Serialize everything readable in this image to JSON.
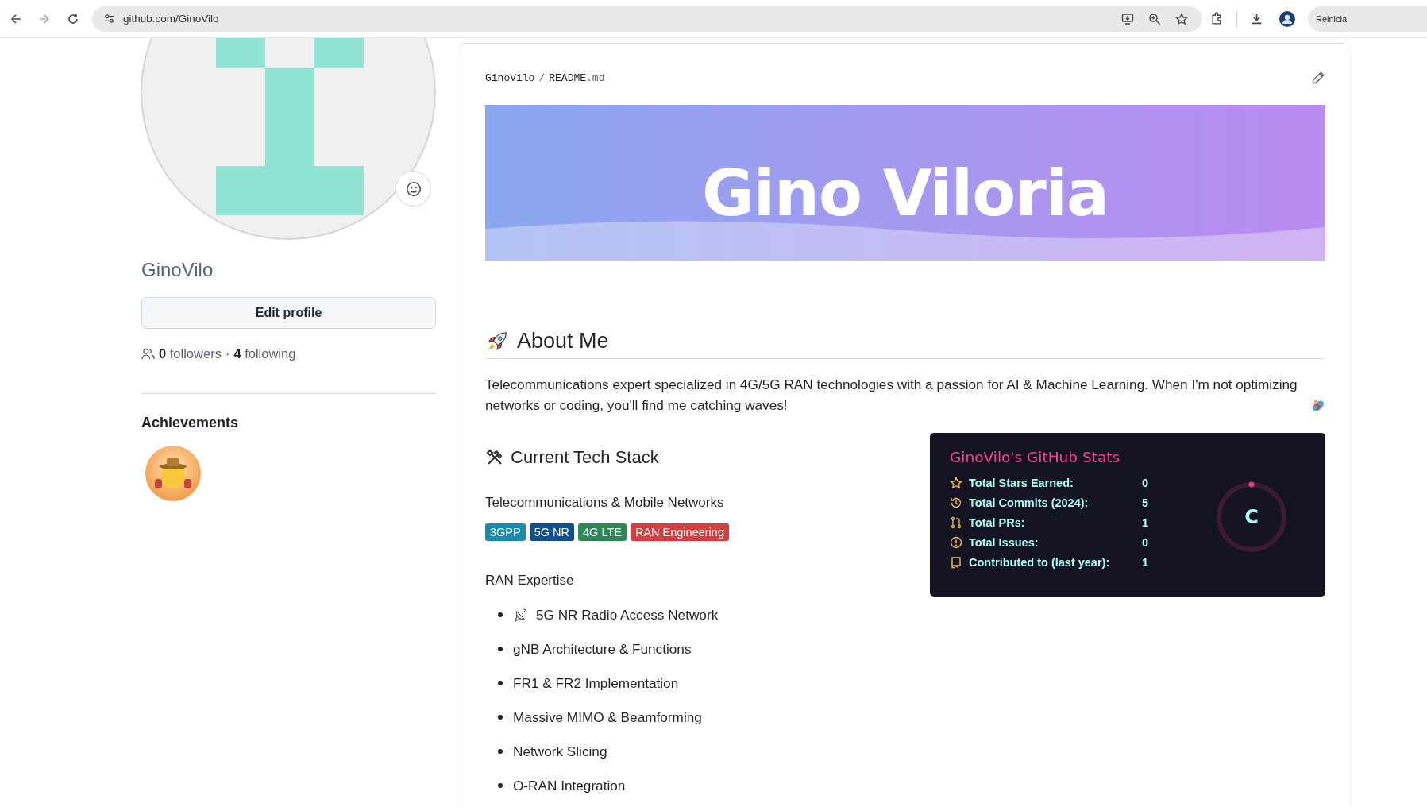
{
  "browser": {
    "url": "github.com/GinoVilo",
    "profile_button": "Reinicia"
  },
  "profile": {
    "username": "GinoVilo",
    "edit_button": "Edit profile",
    "followers_count": "0",
    "followers_label": "followers",
    "separator": "·",
    "following_count": "4",
    "following_label": "following",
    "achievements_title": "Achievements"
  },
  "readme": {
    "owner": "GinoVilo",
    "separator": "/",
    "file": "README.md",
    "banner_title": "Gino Viloria",
    "about_heading": "About Me",
    "about_text": "Telecommunications expert specialized in 4G/5G RAN technologies with a passion for AI & Machine Learning. When I'm not optimizing networks or coding, you'll find me catching waves!",
    "tech_heading": "Current Tech Stack",
    "telecom_heading": "Telecommunications & Mobile Networks",
    "badges": [
      {
        "label": "3GPP",
        "color": "#1a8cb0"
      },
      {
        "label": "5G NR",
        "color": "#0f4f8e"
      },
      {
        "label": "4G LTE",
        "color": "#2f8757"
      },
      {
        "label": "RAN Engineering",
        "color": "#d43f3f"
      }
    ],
    "ran_heading": "RAN Expertise",
    "ran_items": [
      {
        "text": "5G NR Radio Access Network",
        "kind": "satellite"
      },
      {
        "text": "gNB Architecture & Functions",
        "kind": "plain"
      },
      {
        "text": "FR1 & FR2 Implementation",
        "kind": "plain"
      },
      {
        "text": "Massive MIMO & Beamforming",
        "kind": "plain"
      },
      {
        "text": "Network Slicing",
        "kind": "plain"
      },
      {
        "text": "O-RAN Integration",
        "kind": "plain"
      }
    ]
  },
  "stats_card": {
    "title": "GinoVilo's GitHub Stats",
    "rank": "C",
    "rows": [
      {
        "label": "Total Stars Earned:",
        "value": "0",
        "kind": "star"
      },
      {
        "label": "Total Commits (2024):",
        "value": "5",
        "kind": "commits"
      },
      {
        "label": "Total PRs:",
        "value": "1",
        "kind": "prs"
      },
      {
        "label": "Total Issues:",
        "value": "0",
        "kind": "issues"
      },
      {
        "label": "Contributed to (last year):",
        "value": "1",
        "kind": "contrib"
      }
    ]
  }
}
